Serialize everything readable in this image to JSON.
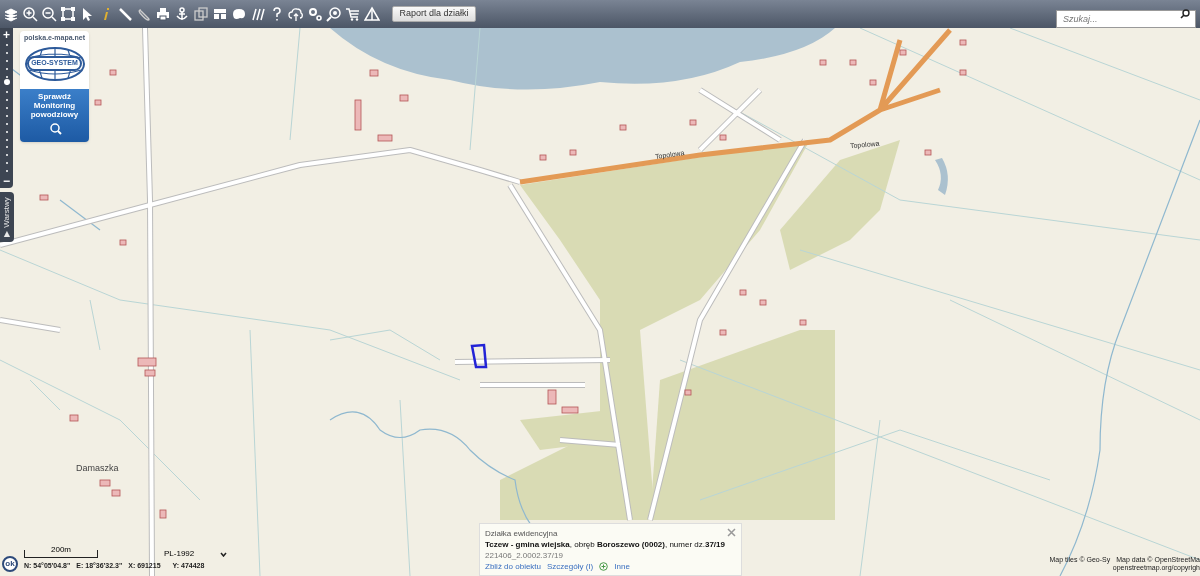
{
  "toolbar": {
    "report_button": "Raport dla działki",
    "search": {
      "placeholder": "Szukaj..."
    }
  },
  "zoom_bar": {
    "plus": "+",
    "minus": "−",
    "level": 0.72
  },
  "promo": {
    "site": "polska.e-mapa.net",
    "logo": "GEO-SYSTEM",
    "text": "Sprawdź Monitoring powodziowy"
  },
  "layers_tab": {
    "arrow": "▶",
    "label": "Warstwy"
  },
  "map_labels": [
    {
      "text": "Topolowa",
      "kind": "street"
    },
    {
      "text": "Topolowa",
      "kind": "street"
    },
    {
      "text": "Damaszka",
      "kind": "place"
    }
  ],
  "status": {
    "ok_button": "ok",
    "scale": "200m",
    "projection": "PL-1992",
    "n": "N: 54°05'04.8\"",
    "e": "E: 18°36'32.3\"",
    "x": "X: 691215",
    "y": "Y: 474428"
  },
  "popup": {
    "title": "Działka ewidencyjna",
    "description": "**Tczew - gmina wiejska**, obręb **Boroszewo (0002)**, numer dz.**37/19**",
    "id": "221406_2.0002.37/19",
    "links": [
      "Zbliż do obiektu",
      "Szczegóły (I)",
      "Inne"
    ]
  },
  "attribution": {
    "tiles": "Map tiles © Geo-Sy",
    "data": "Map data © OpenStreetMa",
    "copyright": "openstreetmap.org/copyrigh"
  }
}
